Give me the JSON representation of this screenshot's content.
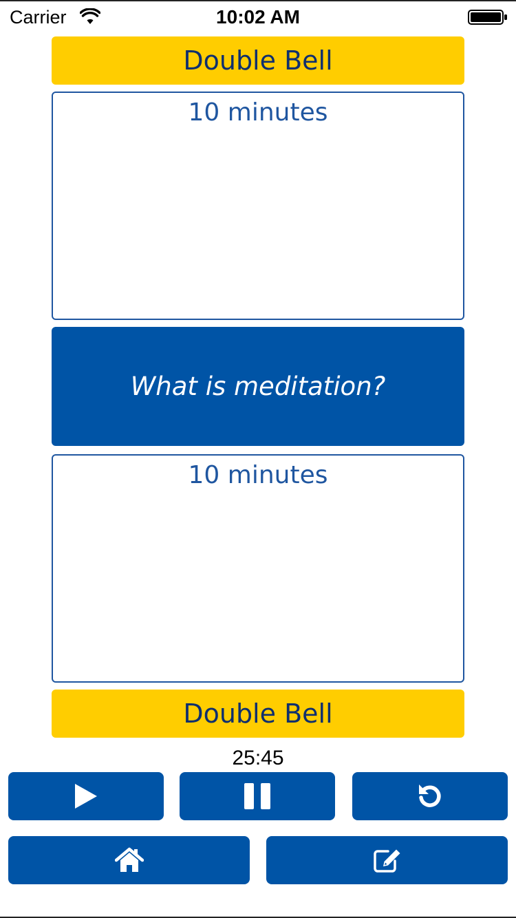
{
  "status_bar": {
    "carrier": "Carrier",
    "time": "10:02 AM",
    "wifi_icon": "wifi-icon",
    "battery_icon": "battery-full-icon"
  },
  "sequence": {
    "top_bell": "Double Bell",
    "first_timer": "10 minutes",
    "question": "What is meditation?",
    "second_timer": "10 minutes",
    "bottom_bell": "Double Bell"
  },
  "countdown": "25:45",
  "controls": {
    "play_icon": "play-icon",
    "pause_icon": "pause-icon",
    "reset_icon": "reset-icon",
    "home_icon": "home-icon",
    "edit_icon": "edit-icon"
  },
  "colors": {
    "primary_blue": "#0054a6",
    "bell_yellow": "#ffcd00",
    "timer_text": "#1f56a0",
    "bell_text": "#0f2f6e"
  }
}
